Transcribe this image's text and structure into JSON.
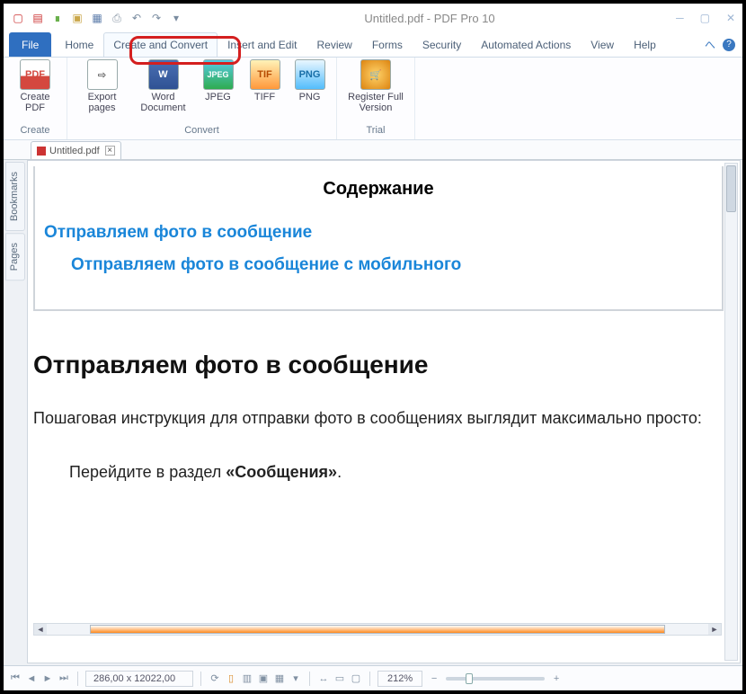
{
  "window": {
    "title": "Untitled.pdf - PDF Pro 10"
  },
  "qat": {
    "icon_names": [
      "app-icon",
      "pdf-icon",
      "new-icon",
      "open-icon",
      "save-icon",
      "print-icon",
      "undo-icon",
      "redo-icon",
      "customize-icon"
    ]
  },
  "ribbon": {
    "file_label": "File",
    "tabs": [
      {
        "label": "Home"
      },
      {
        "label": "Create and Convert"
      },
      {
        "label": "Insert and Edit"
      },
      {
        "label": "Review"
      },
      {
        "label": "Forms"
      },
      {
        "label": "Security"
      },
      {
        "label": "Automated Actions"
      },
      {
        "label": "View"
      },
      {
        "label": "Help"
      }
    ],
    "active_tab_index": 1,
    "groups": [
      {
        "name": "Create",
        "items": [
          {
            "label": "Create PDF",
            "icon_text": "PDF",
            "icon_name": "pdf-icon"
          }
        ]
      },
      {
        "name": "Convert",
        "items": [
          {
            "label": "Export pages",
            "icon_text": "⇨",
            "icon_name": "export-icon"
          },
          {
            "label": "Word Document",
            "icon_text": "W",
            "icon_name": "word-icon"
          },
          {
            "label": "JPEG",
            "icon_text": "JPEG",
            "icon_name": "jpeg-icon"
          },
          {
            "label": "TIFF",
            "icon_text": "TIF",
            "icon_name": "tiff-icon"
          },
          {
            "label": "PNG",
            "icon_text": "PNG",
            "icon_name": "png-icon"
          }
        ]
      },
      {
        "name": "Trial",
        "items": [
          {
            "label": "Register Full Version",
            "icon_text": "🛒",
            "icon_name": "register-icon"
          }
        ]
      }
    ]
  },
  "doc_tabs": [
    {
      "label": "Untitled.pdf"
    }
  ],
  "side_panels": [
    {
      "label": "Bookmarks"
    },
    {
      "label": "Pages"
    }
  ],
  "document": {
    "toc_title": "Содержание",
    "toc_items": [
      {
        "text": "Отправляем фото в сообщение",
        "indent": false
      },
      {
        "text": "Отправляем фото в сообщение с мобильного",
        "indent": true
      }
    ],
    "heading1": "Отправляем фото в сообщение",
    "para1": "Пошаговая инструкция для отправки фото в сообщениях выглядит максимально просто:",
    "step1_prefix": "Перейдите в раздел ",
    "step1_bold": "«Сообщения»",
    "step1_suffix": "."
  },
  "status": {
    "coords": "286,00 x 12022,00",
    "zoom_value": "212%"
  }
}
